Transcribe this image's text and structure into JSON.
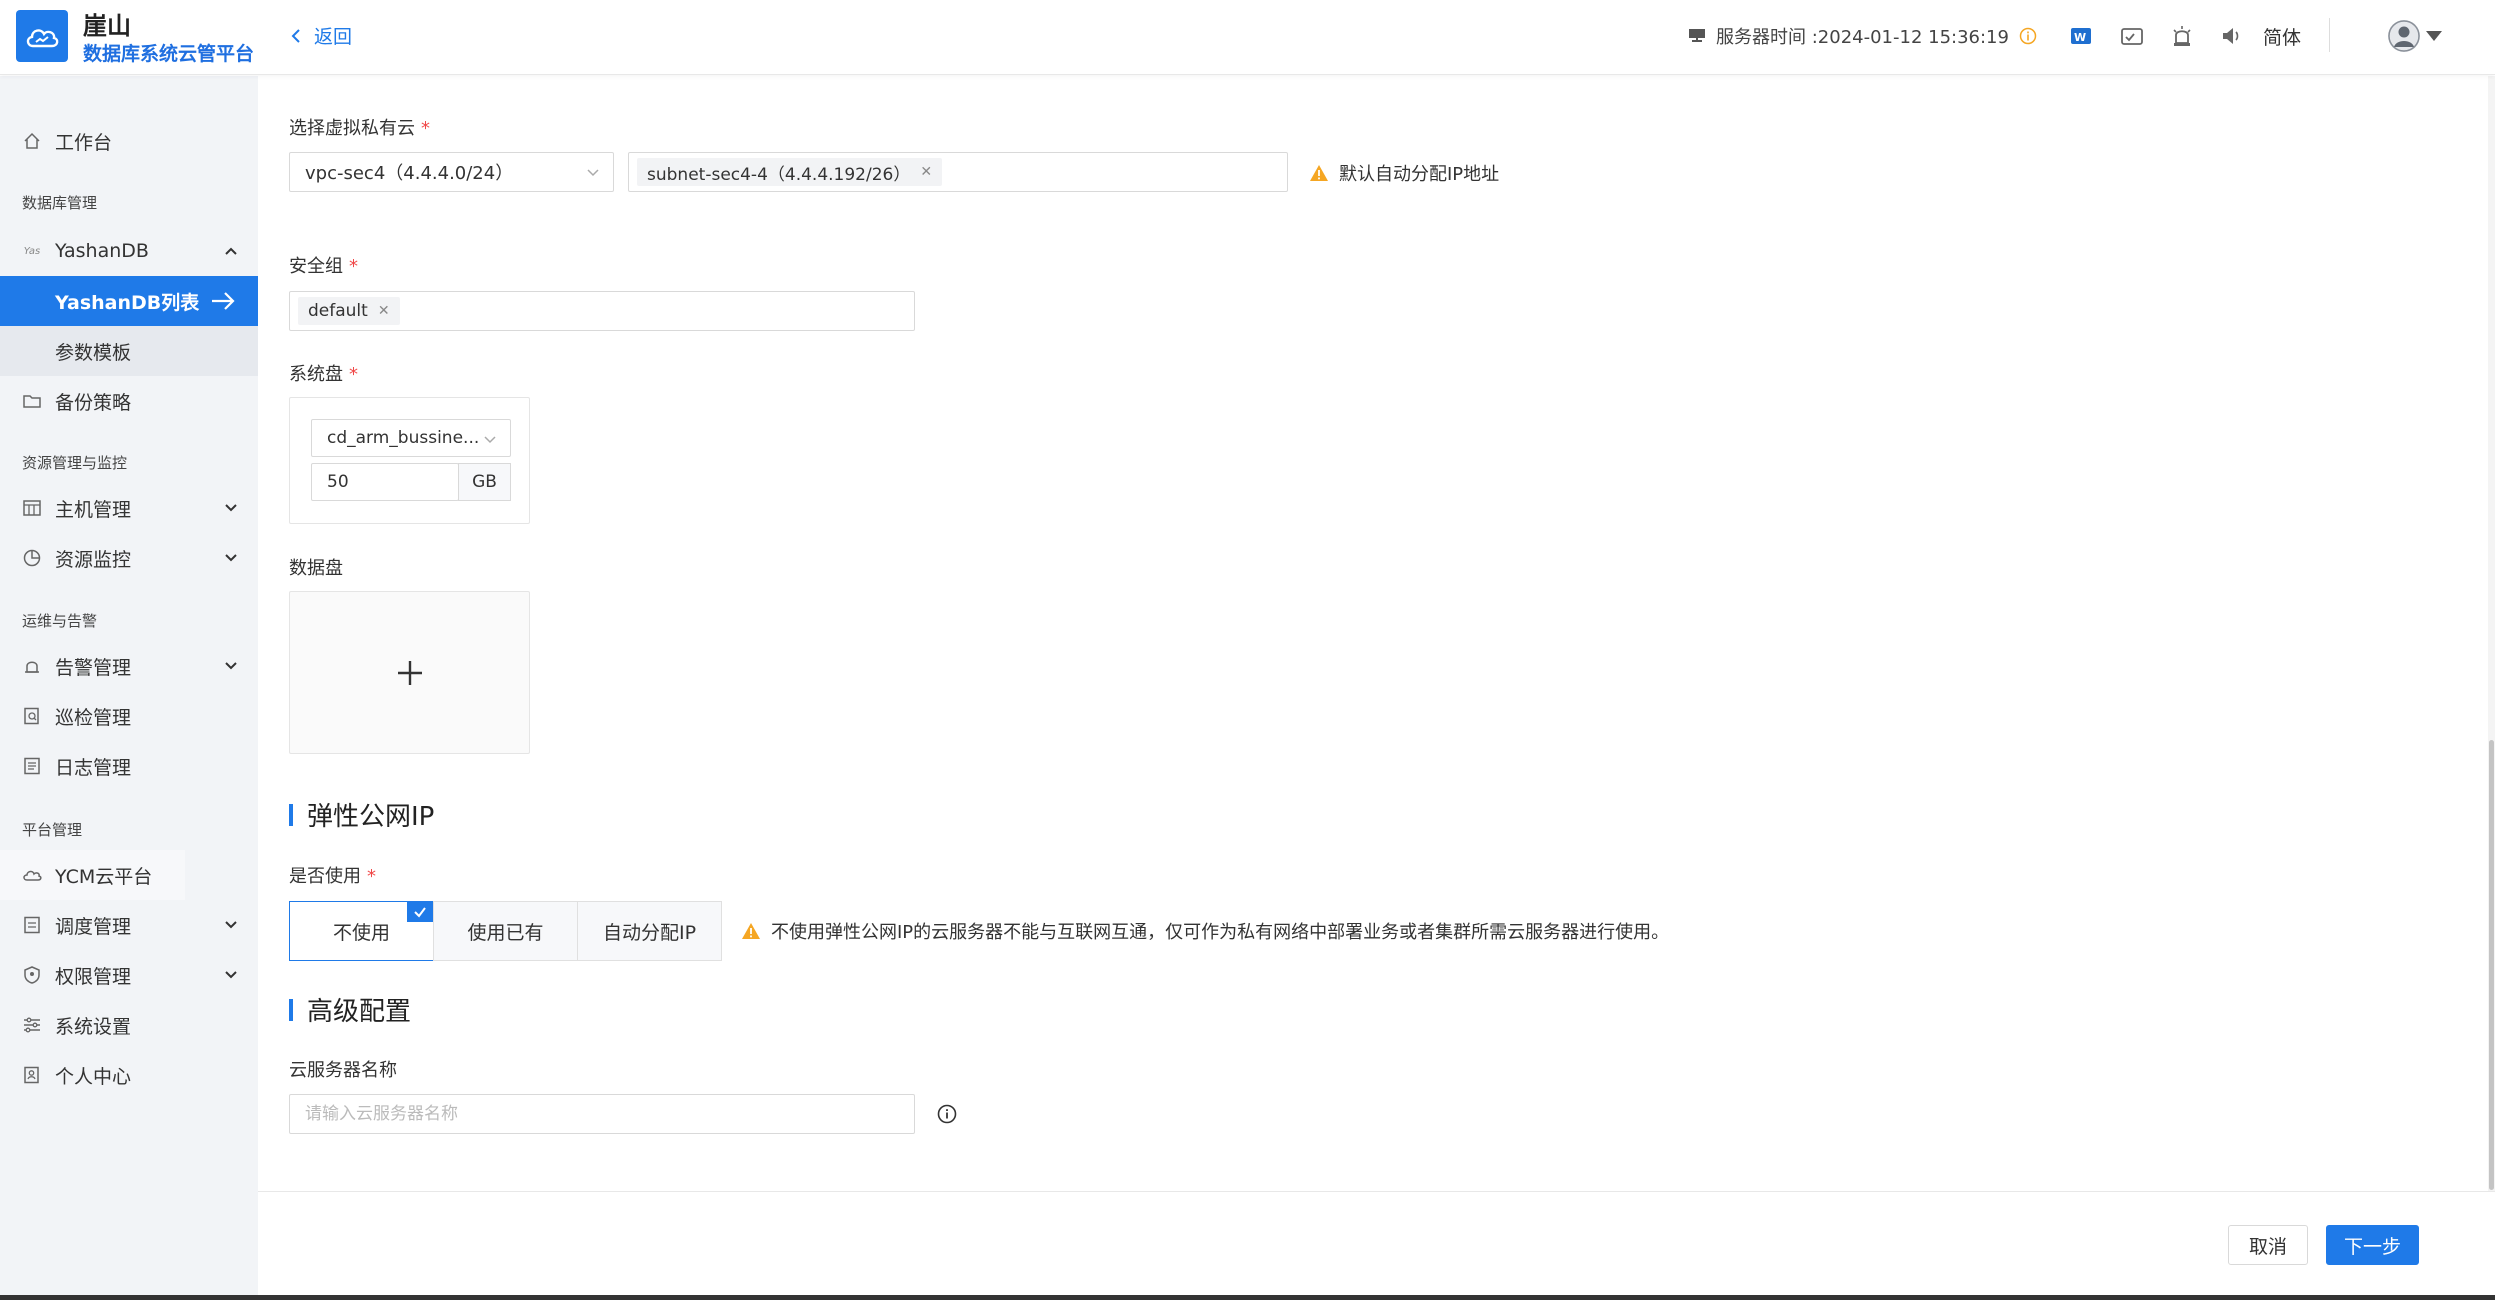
{
  "header": {
    "brand_title": "崖山",
    "brand_subtitle": "数据库系统云管平台",
    "back_label": "返回",
    "server_time": "服务器时间 :2024-01-12 15:36:19",
    "language": "简体"
  },
  "sidebar": {
    "workbench": "工作台",
    "section_db": "数据库管理",
    "yashandb": "YashanDB",
    "yashandb_list": "YashanDB列表",
    "param_template": "参数模板",
    "backup_policy": "备份策略",
    "section_resource": "资源管理与监控",
    "host_mgmt": "主机管理",
    "resource_monitor": "资源监控",
    "section_ops": "运维与告警",
    "alarm_mgmt": "告警管理",
    "inspect_mgmt": "巡检管理",
    "log_mgmt": "日志管理",
    "section_platform": "平台管理",
    "ycm_cloud": "YCM云平台",
    "schedule_mgmt": "调度管理",
    "perm_mgmt": "权限管理",
    "system_settings": "系统设置",
    "personal_center": "个人中心"
  },
  "form": {
    "vpc_label": "选择虚拟私有云",
    "vpc_value": "vpc-sec4（4.4.4.0/24）",
    "subnet_tag": "subnet-sec4-4（4.4.4.192/26）",
    "vpc_warning": "默认自动分配IP地址",
    "sg_label": "安全组",
    "sg_tag": "default",
    "sysdisk_label": "系统盘",
    "sysdisk_type": "cd_arm_bussine...",
    "sysdisk_size": "50",
    "sysdisk_unit": "GB",
    "datadisk_label": "数据盘",
    "eip_title": "弹性公网IP",
    "eip_use_label": "是否使用",
    "eip_options": [
      "不使用",
      "使用已有",
      "自动分配IP"
    ],
    "eip_warning": "不使用弹性公网IP的云服务器不能与互联网互通，仅可作为私有网络中部署业务或者集群所需云服务器进行使用。",
    "advanced_title": "高级配置",
    "server_name_label": "云服务器名称",
    "server_name_placeholder": "请输入云服务器名称"
  },
  "footer": {
    "cancel": "取消",
    "next": "下一步"
  },
  "colors": {
    "primary": "#1f7ae8",
    "warning": "#f5a623",
    "required": "#f04848"
  }
}
